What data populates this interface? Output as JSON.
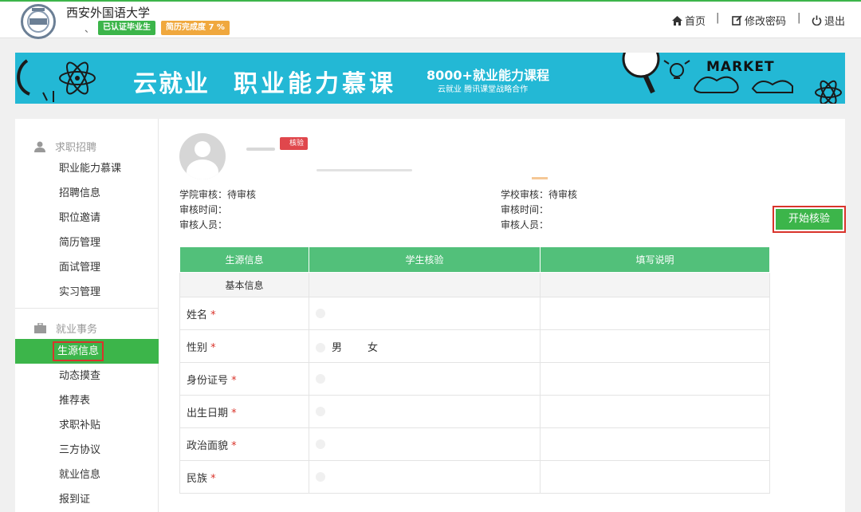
{
  "header": {
    "school_name": "西安外国语大学",
    "tick": "、",
    "badge_verified": "已认证毕业生",
    "badge_resume": "简历完成度 7 %",
    "nav": {
      "home": "首页",
      "change_password": "修改密码",
      "logout": "退出",
      "separator": "|"
    }
  },
  "banner": {
    "brand": "云就业",
    "title": "职业能力慕课",
    "sub": "8000+就业能力课程",
    "sub2": "云就业 腾讯课堂战略合作",
    "market": "MARKET"
  },
  "sidebar": {
    "group1": "求职招聘",
    "group1_items": [
      "职业能力慕课",
      "招聘信息",
      "职位邀请",
      "简历管理",
      "面试管理",
      "实习管理"
    ],
    "group2": "就业事务",
    "group2_items": [
      "生源信息",
      "动态摸查",
      "推荐表",
      "求职补贴",
      "三方协议",
      "就业信息",
      "报到证"
    ],
    "active_item": "生源信息"
  },
  "profile": {
    "pending_tag": "核验"
  },
  "audit": {
    "college": {
      "review": "学院审核：待审核",
      "time": "审核时间：",
      "person": "审核人员："
    },
    "school": {
      "review": "学校审核：待审核",
      "time": "审核时间：",
      "person": "审核人员："
    }
  },
  "start_button": "开始核验",
  "table": {
    "headers": [
      "生源信息",
      "学生核验",
      "填写说明"
    ],
    "section": "基本信息",
    "rows": [
      {
        "label": "姓名",
        "required": "*"
      },
      {
        "label": "性别",
        "required": "*",
        "options": [
          "男",
          "女"
        ]
      },
      {
        "label": "身份证号",
        "required": "*"
      },
      {
        "label": "出生日期",
        "required": "*"
      },
      {
        "label": "政治面貌",
        "required": "*"
      },
      {
        "label": "民族",
        "required": "*"
      }
    ]
  },
  "colors": {
    "green": "#3cb54a",
    "table_header": "#52c07a",
    "banner": "#23b8d5",
    "highlight_border": "#d9342b"
  }
}
